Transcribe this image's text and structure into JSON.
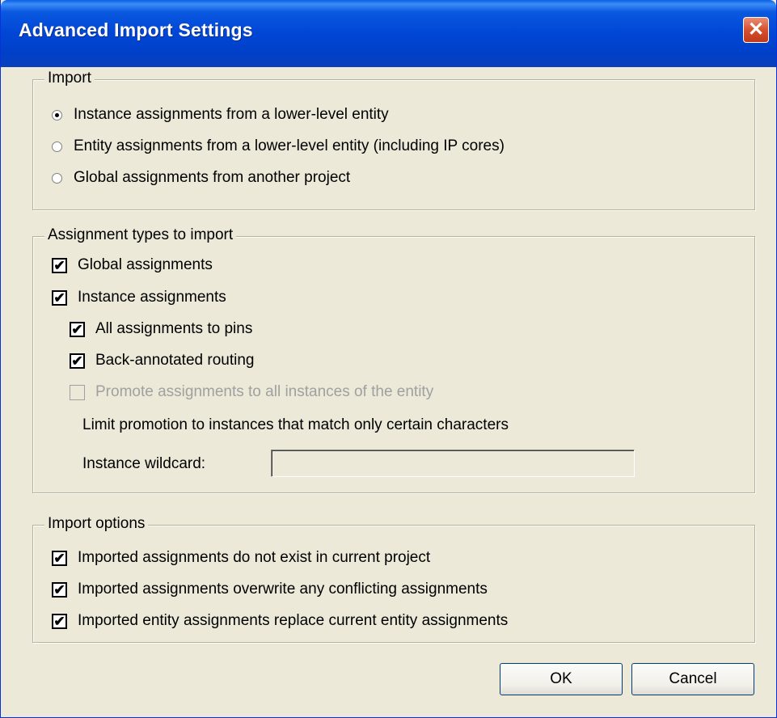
{
  "window": {
    "title": "Advanced Import Settings"
  },
  "titlebar": {
    "close_icon": "close-icon"
  },
  "import_group": {
    "legend": "Import",
    "options": [
      {
        "label": "Instance assignments from a lower-level entity",
        "selected": true
      },
      {
        "label": "Entity assignments from a lower-level entity (including IP cores)",
        "selected": false
      },
      {
        "label": "Global assignments from another project",
        "selected": false
      }
    ]
  },
  "types_group": {
    "legend": "Assignment types to import",
    "global": {
      "label": "Global assignments",
      "checked": true
    },
    "instance": {
      "label": "Instance assignments",
      "checked": true
    },
    "pins": {
      "label": "All assignments to pins",
      "checked": true
    },
    "routing": {
      "label": "Back-annotated routing",
      "checked": true
    },
    "promote": {
      "label": "Promote assignments to all instances of the entity",
      "checked": false,
      "enabled": false
    },
    "limit_text": "Limit promotion to instances that match only certain characters",
    "wildcard_label": "Instance wildcard:",
    "wildcard_value": ""
  },
  "options_group": {
    "legend": "Import options",
    "items": [
      {
        "label": "Imported assignments do not exist in current project",
        "checked": true
      },
      {
        "label": "Imported assignments overwrite any conflicting assignments",
        "checked": true
      },
      {
        "label": "Imported entity assignments replace current entity assignments",
        "checked": true
      }
    ]
  },
  "buttons": {
    "ok": "OK",
    "cancel": "Cancel"
  },
  "glyphs": {
    "check": "✔",
    "close": "✕"
  },
  "colors": {
    "title_bar": "#0046d5",
    "dialog_bg": "#ece9d8",
    "close_button": "#d6502e",
    "disabled_text": "#a0a0a0"
  }
}
